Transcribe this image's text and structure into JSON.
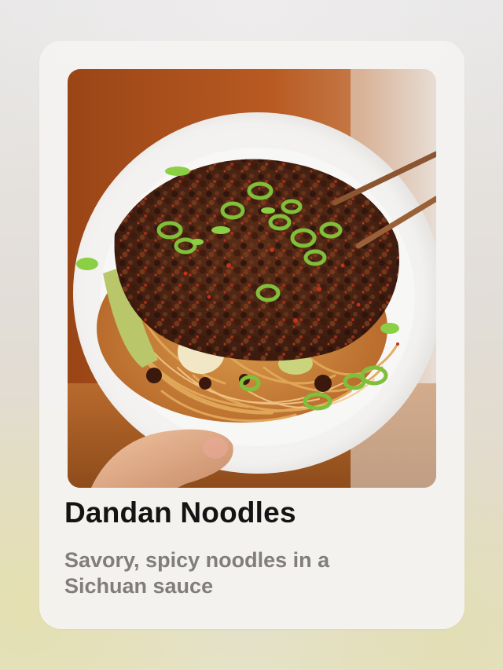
{
  "card": {
    "title": "Dandan Noodles",
    "description": "Savory, spicy noodles in a Sichuan sauce",
    "image_subject": "dandan-noodles-photo"
  },
  "colors": {
    "title": "#141414",
    "description": "#827d7a",
    "card_background": "#f4f3f2"
  }
}
